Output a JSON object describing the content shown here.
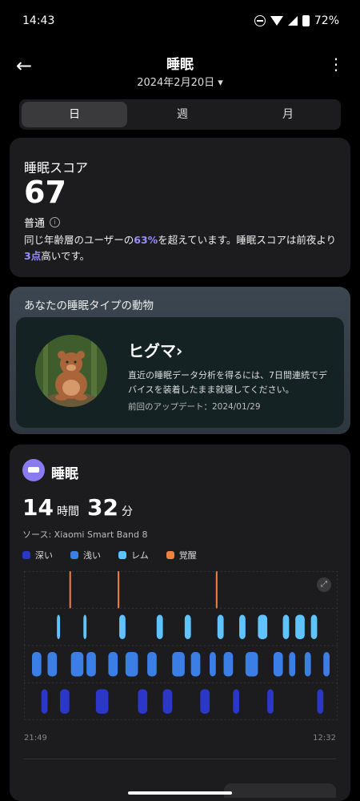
{
  "status_bar": {
    "time": "14:43",
    "battery": "72%"
  },
  "header": {
    "title": "睡眠",
    "date": "2024年2月20日 ▾"
  },
  "tabs": [
    "日",
    "週",
    "月"
  ],
  "score": {
    "heading": "睡眠スコア",
    "value": "67",
    "level": "普通",
    "desc_1": "同じ年齢層のユーザーの",
    "desc_pct": "63%",
    "desc_2": "を超えています。睡眠スコアは前夜より",
    "desc_pts": "3点",
    "desc_3": "高いです。"
  },
  "animal": {
    "heading": "あなたの睡眠タイプの動物",
    "name": "ヒグマ›",
    "description": "直近の睡眠データ分析を得るには、7日間連続でデバイスを装着したまま就寝してください。",
    "updated": "前回のアップデート：2024/01/29"
  },
  "sleep": {
    "heading": "睡眠",
    "hours": "14",
    "hours_unit": "時間",
    "minutes": "32",
    "minutes_unit": "分",
    "source": "ソース: Xiaomi Smart Band 8",
    "legend": [
      {
        "label": "深い",
        "color": "#2b37c9"
      },
      {
        "label": "浅い",
        "color": "#3b7fe6"
      },
      {
        "label": "レム",
        "color": "#5fc3ff"
      },
      {
        "label": "覚醒",
        "color": "#f08040"
      }
    ],
    "start_time": "21:49",
    "end_time": "12:32"
  },
  "chart_data": {
    "type": "area",
    "title": "",
    "x_start": "21:49",
    "x_end": "12:32",
    "stages": [
      "覚醒",
      "レム",
      "浅い",
      "深い"
    ],
    "segments": [
      {
        "stage": "浅い",
        "len": 3
      },
      {
        "stage": "深い",
        "len": 2
      },
      {
        "stage": "浅い",
        "len": 3
      },
      {
        "stage": "レム",
        "len": 1
      },
      {
        "stage": "深い",
        "len": 3
      },
      {
        "stage": "覚醒",
        "len": 0.5
      },
      {
        "stage": "浅い",
        "len": 4
      },
      {
        "stage": "レム",
        "len": 1
      },
      {
        "stage": "浅い",
        "len": 3
      },
      {
        "stage": "深い",
        "len": 4
      },
      {
        "stage": "浅い",
        "len": 3
      },
      {
        "stage": "覚醒",
        "len": 0.5
      },
      {
        "stage": "レム",
        "len": 2
      },
      {
        "stage": "浅い",
        "len": 4
      },
      {
        "stage": "深い",
        "len": 3
      },
      {
        "stage": "浅い",
        "len": 3
      },
      {
        "stage": "レム",
        "len": 2
      },
      {
        "stage": "深い",
        "len": 3
      },
      {
        "stage": "浅い",
        "len": 4
      },
      {
        "stage": "レム",
        "len": 2
      },
      {
        "stage": "浅い",
        "len": 3
      },
      {
        "stage": "深い",
        "len": 3
      },
      {
        "stage": "浅い",
        "len": 2
      },
      {
        "stage": "覚醒",
        "len": 0.5
      },
      {
        "stage": "レム",
        "len": 2
      },
      {
        "stage": "浅い",
        "len": 3
      },
      {
        "stage": "深い",
        "len": 2
      },
      {
        "stage": "レム",
        "len": 2
      },
      {
        "stage": "浅い",
        "len": 4
      },
      {
        "stage": "レム",
        "len": 3
      },
      {
        "stage": "深い",
        "len": 2
      },
      {
        "stage": "浅い",
        "len": 3
      },
      {
        "stage": "レム",
        "len": 2
      },
      {
        "stage": "浅い",
        "len": 2
      },
      {
        "stage": "レム",
        "len": 3
      },
      {
        "stage": "浅い",
        "len": 2
      },
      {
        "stage": "レム",
        "len": 2
      },
      {
        "stage": "深い",
        "len": 2
      },
      {
        "stage": "浅い",
        "len": 2
      }
    ],
    "colors": {
      "覚醒": "#f08040",
      "レム": "#5fc3ff",
      "浅い": "#3b7fe6",
      "深い": "#2b37c9"
    }
  }
}
